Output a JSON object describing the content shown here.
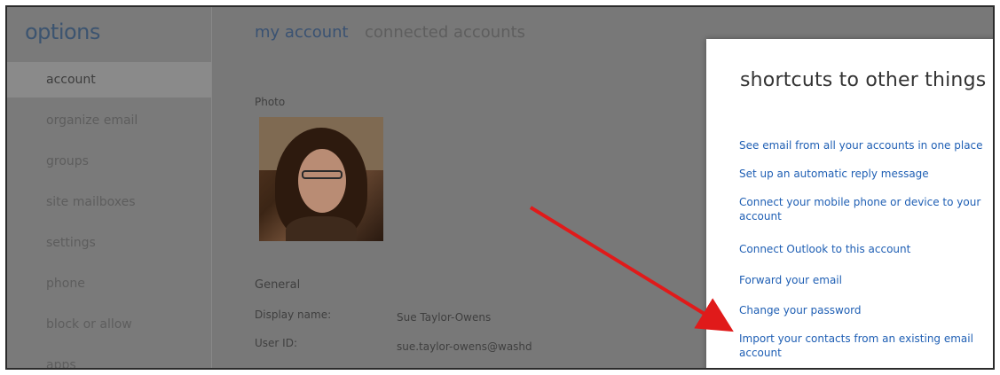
{
  "sidebar": {
    "title": "options",
    "items": [
      {
        "label": "account",
        "selected": true
      },
      {
        "label": "organize email",
        "selected": false
      },
      {
        "label": "groups",
        "selected": false
      },
      {
        "label": "site mailboxes",
        "selected": false
      },
      {
        "label": "settings",
        "selected": false
      },
      {
        "label": "phone",
        "selected": false
      },
      {
        "label": "block or allow",
        "selected": false
      },
      {
        "label": "apps",
        "selected": false
      }
    ]
  },
  "main": {
    "tabs": [
      {
        "label": "my account",
        "active": true
      },
      {
        "label": "connected accounts",
        "active": false
      }
    ],
    "photo_label": "Photo",
    "general_heading": "General",
    "fields": [
      {
        "label": "Display name:",
        "value": "Sue Taylor-Owens"
      },
      {
        "label": "User ID:",
        "value": "sue.taylor-owens@washd"
      }
    ]
  },
  "shortcuts": {
    "title": "shortcuts to other things ...",
    "links": [
      "See email from all your accounts in one place",
      "Set up an automatic reply message",
      "Connect your mobile phone or device to your account",
      "Connect Outlook to this account",
      "Forward your email",
      "Change your password",
      "Import your contacts from an existing email account"
    ]
  },
  "colors": {
    "link": "#1f5fb4",
    "overlay": "#777777",
    "arrow": "#e01a1a"
  }
}
